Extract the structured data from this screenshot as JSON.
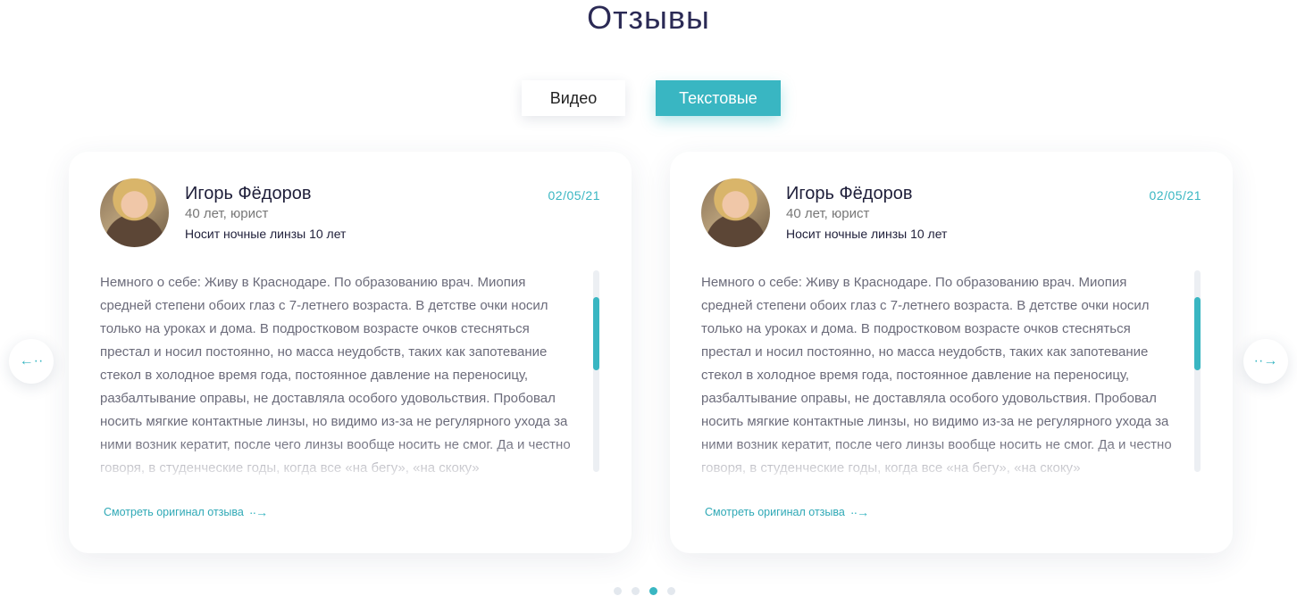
{
  "section": {
    "title": "Отзывы"
  },
  "tabs": [
    {
      "label": "Видео",
      "active": false
    },
    {
      "label": "Текстовые",
      "active": true
    }
  ],
  "colors": {
    "accent": "#39b6c2",
    "title": "#2b2a55"
  },
  "reviews": [
    {
      "name": "Игорь Фёдоров",
      "meta": "40 лет, юрист",
      "wear": "Носит ночные линзы 10 лет",
      "date": "02/05/21",
      "text": "Немного о себе: Живу в Краснодаре. По образованию врач. Миопия средней степени обоих глаз с 7-летнего возраста. В детстве очки носил только на уроках и дома. В подростковом возрасте очков стесняться престал и носил постоянно, но масса неудобств, таких как запотевание стекол в холодное время года, постоянное давление на переносицу, разбалтывание оправы, не доставляла особого удовольствия. Пробовал носить мягкие контактные линзы, но видимо из-за не регулярного ухода за ними возник кератит, после чего линзы вообще носить не смог. Да и честно говоря, в студенческие годы, когда все «на бегу», «на скоку»",
      "link_label": "Смотреть оригинал отзыва",
      "link_arrow": "··→"
    },
    {
      "name": "Игорь Фёдоров",
      "meta": "40 лет, юрист",
      "wear": "Носит ночные линзы 10 лет",
      "date": "02/05/21",
      "text": "Немного о себе: Живу в Краснодаре. По образованию врач. Миопия средней степени обоих глаз с 7-летнего возраста. В детстве очки носил только на уроках и дома. В подростковом возрасте очков стесняться престал и носил постоянно, но масса неудобств, таких как запотевание стекол в холодное время года, постоянное давление на переносицу, разбалтывание оправы, не доставляла особого удовольствия. Пробовал носить мягкие контактные линзы, но видимо из-за не регулярного ухода за ними возник кератит, после чего линзы вообще носить не смог. Да и честно говоря, в студенческие годы, когда все «на бегу», «на скоку»",
      "link_label": "Смотреть оригинал отзыва",
      "link_arrow": "··→"
    }
  ],
  "navigation": {
    "prev_icon": "←··",
    "next_icon": "··→",
    "icons": {
      "prev": "arrow-left-icon",
      "next": "arrow-right-icon"
    }
  },
  "pagination": {
    "total": 4,
    "active_index": 2
  }
}
